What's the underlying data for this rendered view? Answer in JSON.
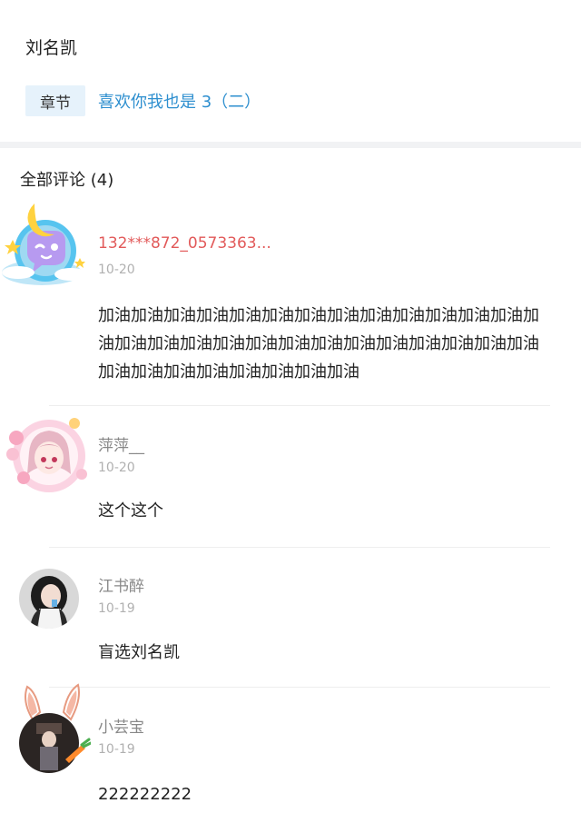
{
  "header": {
    "author_name": "刘名凯",
    "chapter_tag": "章节",
    "chapter_title": "喜欢你我也是 3（二）"
  },
  "comments_section": {
    "title": "全部评论 (4)"
  },
  "comments": [
    {
      "username": "132***872_0573363...",
      "date": "10-20",
      "text": "加油加油加油加油加油加油加油加油加油加油加油加油加油加油加油加油加油加油加油加油加油加油加油加油加油加油加油加油加油加油加油加油加油加油加油",
      "avatar": "moon-cloud-chat-avatar"
    },
    {
      "username": "萍萍__",
      "date": "10-20",
      "text": "这个这个",
      "avatar": "anime-girl-flower-avatar"
    },
    {
      "username": "江书醉",
      "date": "10-19",
      "text": "盲选刘名凯",
      "avatar": "photo-girl-avatar"
    },
    {
      "username": "小芸宝",
      "date": "10-19",
      "text": "222222222",
      "avatar": "bunny-ears-frame-avatar"
    }
  ],
  "colors": {
    "accent_blue": "#2e8fcf",
    "tag_bg": "#e6f2fb",
    "highlight_name": "#e25a5a",
    "muted": "#b0b0b0"
  }
}
